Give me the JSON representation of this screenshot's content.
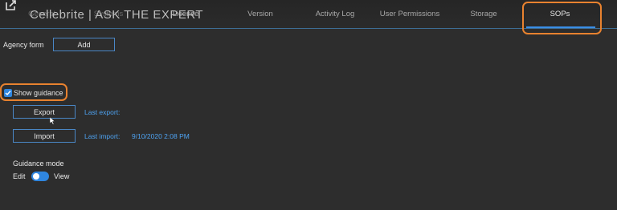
{
  "brand": "Cellebrite | ASK THE EXPERT",
  "tabs": [
    {
      "label": "General",
      "state": "dim"
    },
    {
      "label": "Systems",
      "state": "dim"
    },
    {
      "label": "License",
      "state": "normal"
    },
    {
      "label": "Version",
      "state": "normal"
    },
    {
      "label": "Activity Log",
      "state": "normal"
    },
    {
      "label": "User Permissions",
      "state": "normal"
    },
    {
      "label": "Storage",
      "state": "normal"
    },
    {
      "label": "SOPs",
      "state": "active"
    }
  ],
  "agency": {
    "label": "Agency form",
    "add_label": "Add"
  },
  "guidance": {
    "checkbox_label": "Show guidance",
    "checked": true,
    "export_label": "Export",
    "last_export_label": "Last export:",
    "import_label": "Import",
    "last_import_label": "Last import:",
    "last_import_value": "9/10/2020 2:08 PM"
  },
  "mode": {
    "heading": "Guidance mode",
    "edit_label": "Edit",
    "view_label": "View",
    "value": "View"
  },
  "colors": {
    "accent": "#2f86e0",
    "link": "#4ea3f2",
    "highlight": "#e8822f",
    "background": "#2d2d2d"
  }
}
